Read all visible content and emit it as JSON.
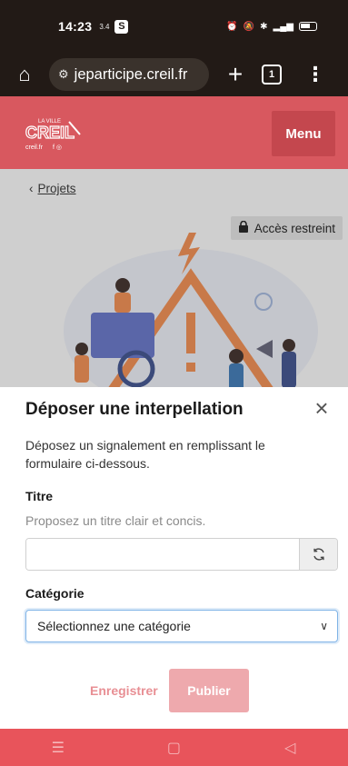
{
  "status_bar": {
    "time": "14:23",
    "small_indicator": "3.4",
    "app_badge": "S"
  },
  "browser": {
    "url": "jeparticipe.creil.fr",
    "tab_count": "1",
    "icons": [
      "home-icon",
      "site-settings-icon",
      "new-tab-icon",
      "tab-switcher-icon",
      "more-icon"
    ]
  },
  "site_header": {
    "logo_top": "LA VILLE",
    "logo_main": "CREIL",
    "logo_bottom": "creil.fr",
    "menu_label": "Menu"
  },
  "page": {
    "breadcrumb": "Projets",
    "access_badge": "Accès restreint"
  },
  "modal": {
    "title": "Déposer une interpellation",
    "description": "Déposez un signalement en remplissant le formulaire ci-dessous.",
    "titre_label": "Titre",
    "titre_help": "Proposez un titre clair et concis.",
    "titre_value": "",
    "categorie_label": "Catégorie",
    "categorie_selected": "Sélectionnez une catégorie",
    "save_label": "Enregistrer",
    "publish_label": "Publier"
  },
  "colors": {
    "brand_red": "#d8585f",
    "nav_red": "#e8545b",
    "publish_disabled": "#eea9ad",
    "focus_blue": "#7fb3e6"
  }
}
